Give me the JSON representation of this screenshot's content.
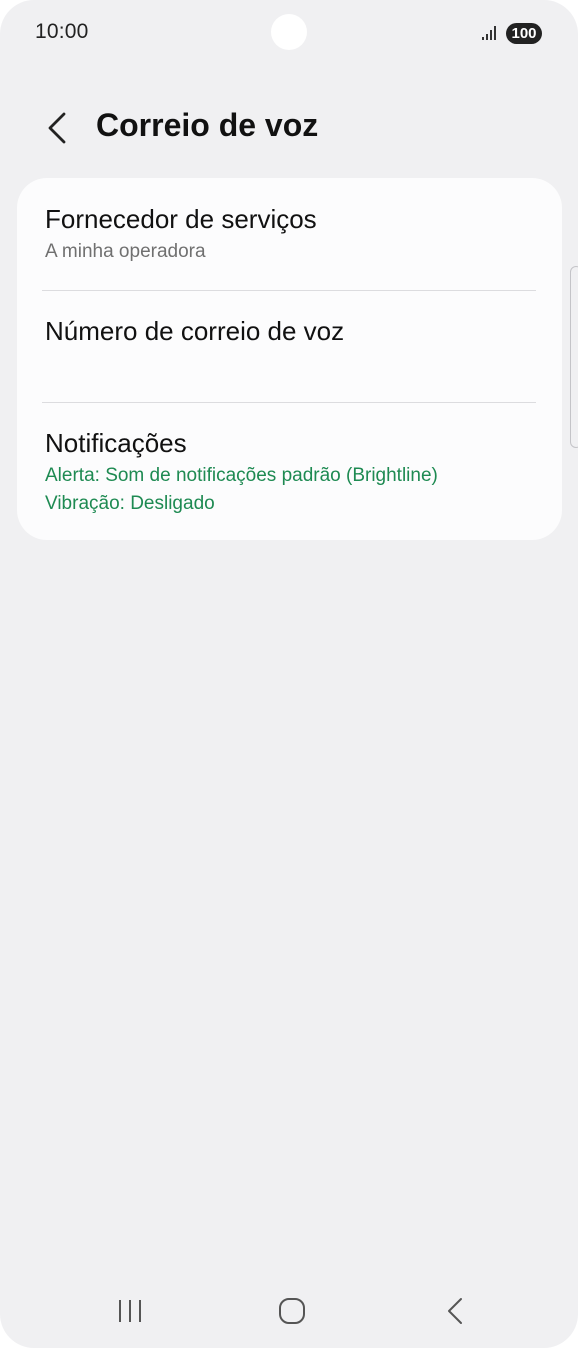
{
  "status_bar": {
    "time": "10:00",
    "battery": "100",
    "signal_icon": "signal-bars-icon"
  },
  "header": {
    "back_icon": "chevron-left-icon",
    "title": "Correio de voz"
  },
  "settings": {
    "items": [
      {
        "title": "Fornecedor de serviços",
        "subtitle": "A minha operadora"
      },
      {
        "title": "Número de correio de voz"
      },
      {
        "title": "Notificações",
        "subtitle_lines": [
          "Alerta: Som de notificações padrão (Brightline)",
          "Vibração: Desligado"
        ]
      }
    ]
  },
  "colors": {
    "background": "#f0f0f2",
    "card": "#fcfcfd",
    "accent_green": "#1e8a52",
    "secondary_text": "#707070"
  },
  "nav_bar": {
    "recents_icon": "recents-icon",
    "home_icon": "home-icon",
    "back_icon": "back-icon"
  }
}
